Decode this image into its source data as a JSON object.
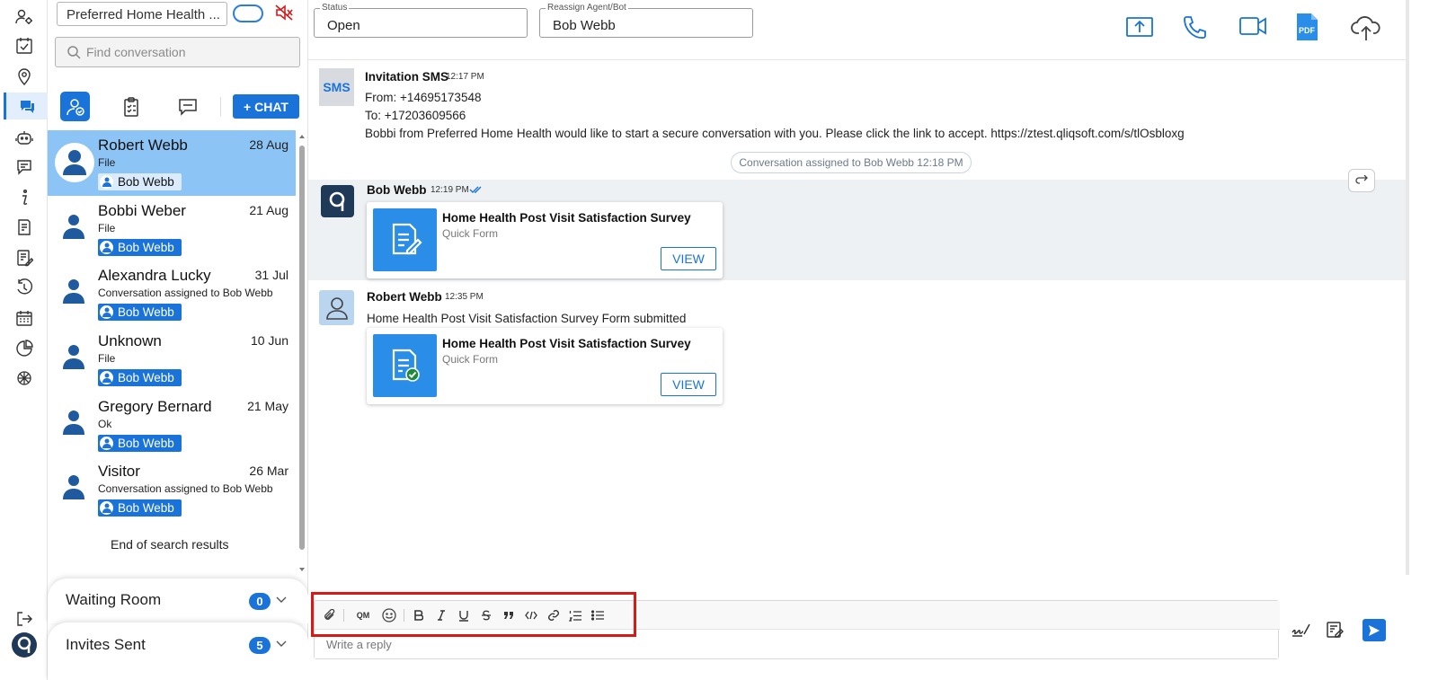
{
  "left_panel": {
    "org_name": "Preferred Home Health ...",
    "search_placeholder": "Find conversation",
    "new_chat_label": "+ CHAT",
    "conversations": [
      {
        "name": "Robert Webb",
        "date": "28 Aug",
        "preview": "File",
        "agent": "Bob Webb",
        "selected": true
      },
      {
        "name": "Bobbi Weber",
        "date": "21 Aug",
        "preview": "File",
        "agent": "Bob Webb"
      },
      {
        "name": "Alexandra Lucky",
        "date": "31 Jul",
        "preview": "Conversation assigned to Bob Webb",
        "agent": "Bob Webb"
      },
      {
        "name": "Unknown",
        "date": "10 Jun",
        "preview": "File",
        "agent": "Bob Webb"
      },
      {
        "name": "Gregory Bernard",
        "date": "21 May",
        "preview": "Ok",
        "agent": "Bob Webb"
      },
      {
        "name": "Visitor",
        "date": "26 Mar",
        "preview": "Conversation assigned to Bob Webb",
        "agent": "Bob Webb"
      }
    ],
    "end_text": "End of search results",
    "waiting_room": {
      "label": "Waiting Room",
      "count": "0"
    },
    "invites_sent": {
      "label": "Invites Sent",
      "count": "5"
    }
  },
  "topbar": {
    "status_legend": "Status",
    "status_value": "Open",
    "agent_legend": "Reassign Agent/Bot",
    "agent_value": "Bob Webb",
    "pdf_label": "PDF"
  },
  "messages": {
    "sms": {
      "avatar": "SMS",
      "sender": "Invitation SMS",
      "time": "12:17 PM",
      "from": "From: +14695173548",
      "to": "To: +17203609566",
      "body": "Bobbi from Preferred Home Health would like to start a secure conversation with you. Please click the link to accept. https://ztest.qliqsoft.com/s/tlOsbloxg"
    },
    "system": "Conversation assigned to Bob Webb 12:18 PM",
    "agent_msg": {
      "sender": "Bob Webb",
      "time": "12:19 PM",
      "card_title": "Home Health Post Visit Satisfaction Survey",
      "card_sub": "Quick Form",
      "view_label": "VIEW"
    },
    "patient_msg": {
      "sender": "Robert Webb",
      "time": "12:35 PM",
      "text": "Home Health Post Visit Satisfaction Survey Form submitted",
      "card_title": "Home Health Post Visit Satisfaction Survey",
      "card_sub": "Quick Form",
      "view_label": "VIEW"
    }
  },
  "composer": {
    "qm_label": "QM",
    "placeholder": "Write a reply",
    "highlight_color": "#d61a1a"
  },
  "colors": {
    "accent": "#1a73d8",
    "selected_row": "#8cc4f5",
    "muted_red": "#d61a1a"
  }
}
